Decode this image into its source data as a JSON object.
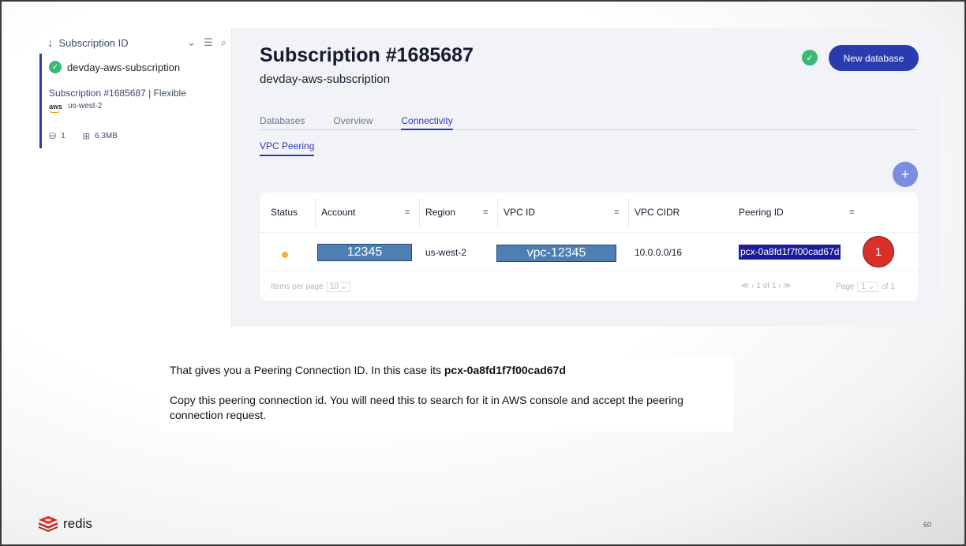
{
  "sidebar": {
    "sort_label": "Subscription ID",
    "subscription": {
      "name": "devday-aws-subscription",
      "meta": "Subscription #1685687 | Flexible",
      "provider": "aws",
      "region": "us-west-2",
      "databases": "1",
      "memory": "6.3MB"
    }
  },
  "header": {
    "title": "Subscription #1685687",
    "subtitle": "devday-aws-subscription",
    "new_db_label": "New database"
  },
  "tabs": [
    {
      "label": "Databases"
    },
    {
      "label": "Overview"
    },
    {
      "label": "Connectivity"
    }
  ],
  "subtab": "VPC Peering",
  "table": {
    "columns": [
      "Status",
      "Account",
      "Region",
      "VPC ID",
      "VPC CIDR",
      "Peering ID"
    ],
    "row": {
      "account": "12345",
      "region": "us-west-2",
      "vpc_id": "vpc-12345",
      "vpc_cidr": "10.0.0.0/16",
      "peering_id": "pcx-0a8fd1f7f00cad67d"
    },
    "marker": "1",
    "footer": {
      "items_per_page_label": "Items per page",
      "items_per_page": "10",
      "pager": "≪  ‹  1 of 1  ›  ≫",
      "page_label": "Page",
      "page_value": "1",
      "page_of": "of 1"
    }
  },
  "caption": {
    "line1_prefix": "That gives you a Peering Connection ID. In this case its ",
    "line1_bold": "pcx-0a8fd1f7f00cad67d",
    "line2": "Copy this peering connection id. You will need this to search for it in AWS console and accept the peering connection request."
  },
  "footer": {
    "brand": "redis",
    "page_number": "60"
  },
  "colors": {
    "accent": "#2a3bb0",
    "success": "#3cb878",
    "status_pending": "#f4b13d",
    "marker": "#d9302a",
    "highlight": "#1d1a9c"
  }
}
